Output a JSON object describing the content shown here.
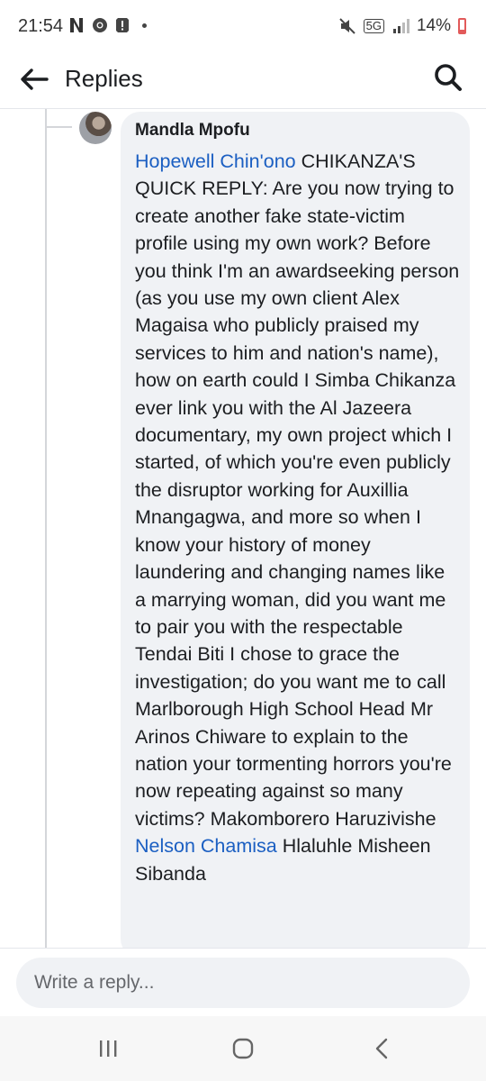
{
  "status_bar": {
    "time": "21:54",
    "left_icons": [
      "netflix-n-icon",
      "chrome-icon",
      "alert-icon",
      "dot"
    ],
    "network": "5G",
    "battery": "14%",
    "battery_color": "#e25a5a"
  },
  "header": {
    "title": "Replies"
  },
  "comment": {
    "author": "Mandla Mpofu",
    "mention": "Hopewell Chin'ono",
    "body": " CHIKANZA'S QUICK REPLY: Are you now trying to create another fake state-victim profile using my own work? Before you think I'm an awardseeking person (as you use my own client Alex Magaisa who publicly praised my services to him and nation's name), how on earth could I Simba Chikanza ever link you with the Al Jazeera documentary, my own project which I started, of which you're even publicly the disruptor working for Auxillia Mnangagwa, and more so when I know your history of money laundering and changing names like a marrying woman, did you want me to pair you with the respectable Tendai Biti I chose to grace the investigation; do you want me to call Marlborough High School Head Mr Arinos Chiware to explain to the nation your tormenting horrors you're now repeating against so many victims? Makomborero Haruzivishe ",
    "mention_2": "Nelson Chamisa",
    "body_tail": " Hlaluhle Misheen Sibanda"
  },
  "composer": {
    "placeholder": "Write a reply..."
  },
  "colors": {
    "link": "#1b5fc2",
    "bubble": "#f0f2f5",
    "text": "#1c1e21"
  }
}
